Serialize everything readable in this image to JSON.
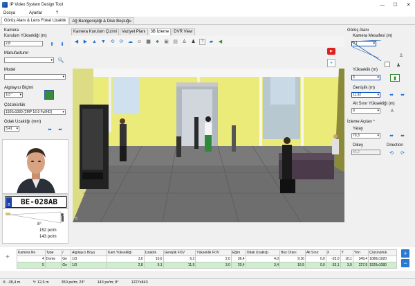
{
  "window": {
    "title": "IP Video System Design Tool",
    "min": "—",
    "max": "☐",
    "close": "✕"
  },
  "menu": [
    "Dosya",
    "Ayarlar",
    "?"
  ],
  "tabs": [
    "Görüş Alanı & Lens Fokal Uzaklık",
    "Ağ Bantgenişliği & Disk Boşluğu"
  ],
  "left": {
    "camera_label": "Kamera",
    "height_label": "Kurulum Yüksekliği (m)",
    "height_value": "2,8",
    "manufacturer_label": "Manufacturer",
    "manufacturer_value": "",
    "model_label": "Model",
    "model_value": "",
    "sensor_label": "Algılayıcı Biçimi",
    "sensor_value": "1/3 \"",
    "resolution_label": "Çözünürlük",
    "resolution_value": "1920x1080 (2MP 16:9 FullHD)",
    "focal_label": "Odak Uzaklığı (mm)",
    "focal_value": "3,41",
    "plate_text": "BE-028AB",
    "plate_country": "B",
    "angle_text": "8°",
    "density1": "152 px/m",
    "density2": "143 px/m"
  },
  "center": {
    "subtabs": [
      "Kamera Kurulum Çizimi",
      "Vaziyet Planı",
      "3B İzleme",
      "DVR View"
    ],
    "active_subtab": 2,
    "scene_corner": "5"
  },
  "right": {
    "fov_title": "Görüş Alanı",
    "distance_label": "Kamera Mesafesi (m)",
    "distance_value": "9,1",
    "height_label": "Yükseklik (m)",
    "height_value": "3",
    "width_label": "Genişlik (m)",
    "width_value": "11,92",
    "lower_label": "Alt Sınır Yüksekliği (m)",
    "lower_value": "0",
    "angles_title": "İzleme Açıları *",
    "yaw_label": "Yatay",
    "yaw_value": "70,3",
    "tilt_label": "Dikey",
    "tilt_value": "43,2",
    "direction_label": "Direction"
  },
  "table": {
    "headers": [
      "Kamera No",
      "Type",
      "/",
      "Algılayıcı Boyu",
      "Kam.Yüksekliği",
      "Uzaklık",
      "Genişlik FOV",
      "Yükseklik FOV",
      "Eğim",
      "Odak Uzaklığı",
      "Boy Oranı",
      "Alt Sınır",
      "X",
      "Y",
      "Yön",
      "Çözünürlük"
    ],
    "rows": [
      [
        "4",
        "Dome",
        "Ge",
        "1/3",
        "3,0",
        "10,6",
        "6,2",
        "2,0",
        "36,4",
        "4,0",
        "9:16",
        "0,0",
        "-33,0",
        "10,1",
        "349,4",
        "1080x1920"
      ],
      [
        "5",
        "",
        "Ge",
        "1/3",
        "2,8",
        "9,1",
        "11,9",
        "3,0",
        "20,4",
        "3,4",
        "16:9",
        "0,0",
        "-33,1",
        "3,9",
        "227,8",
        "1920x1080"
      ]
    ]
  },
  "status": {
    "x": "X: -38,4 m",
    "y": "Y: 12,6 m",
    "d1": "350 px/m; 23°",
    "d2": "143 px/m; 8°",
    "size": "1227x843"
  }
}
